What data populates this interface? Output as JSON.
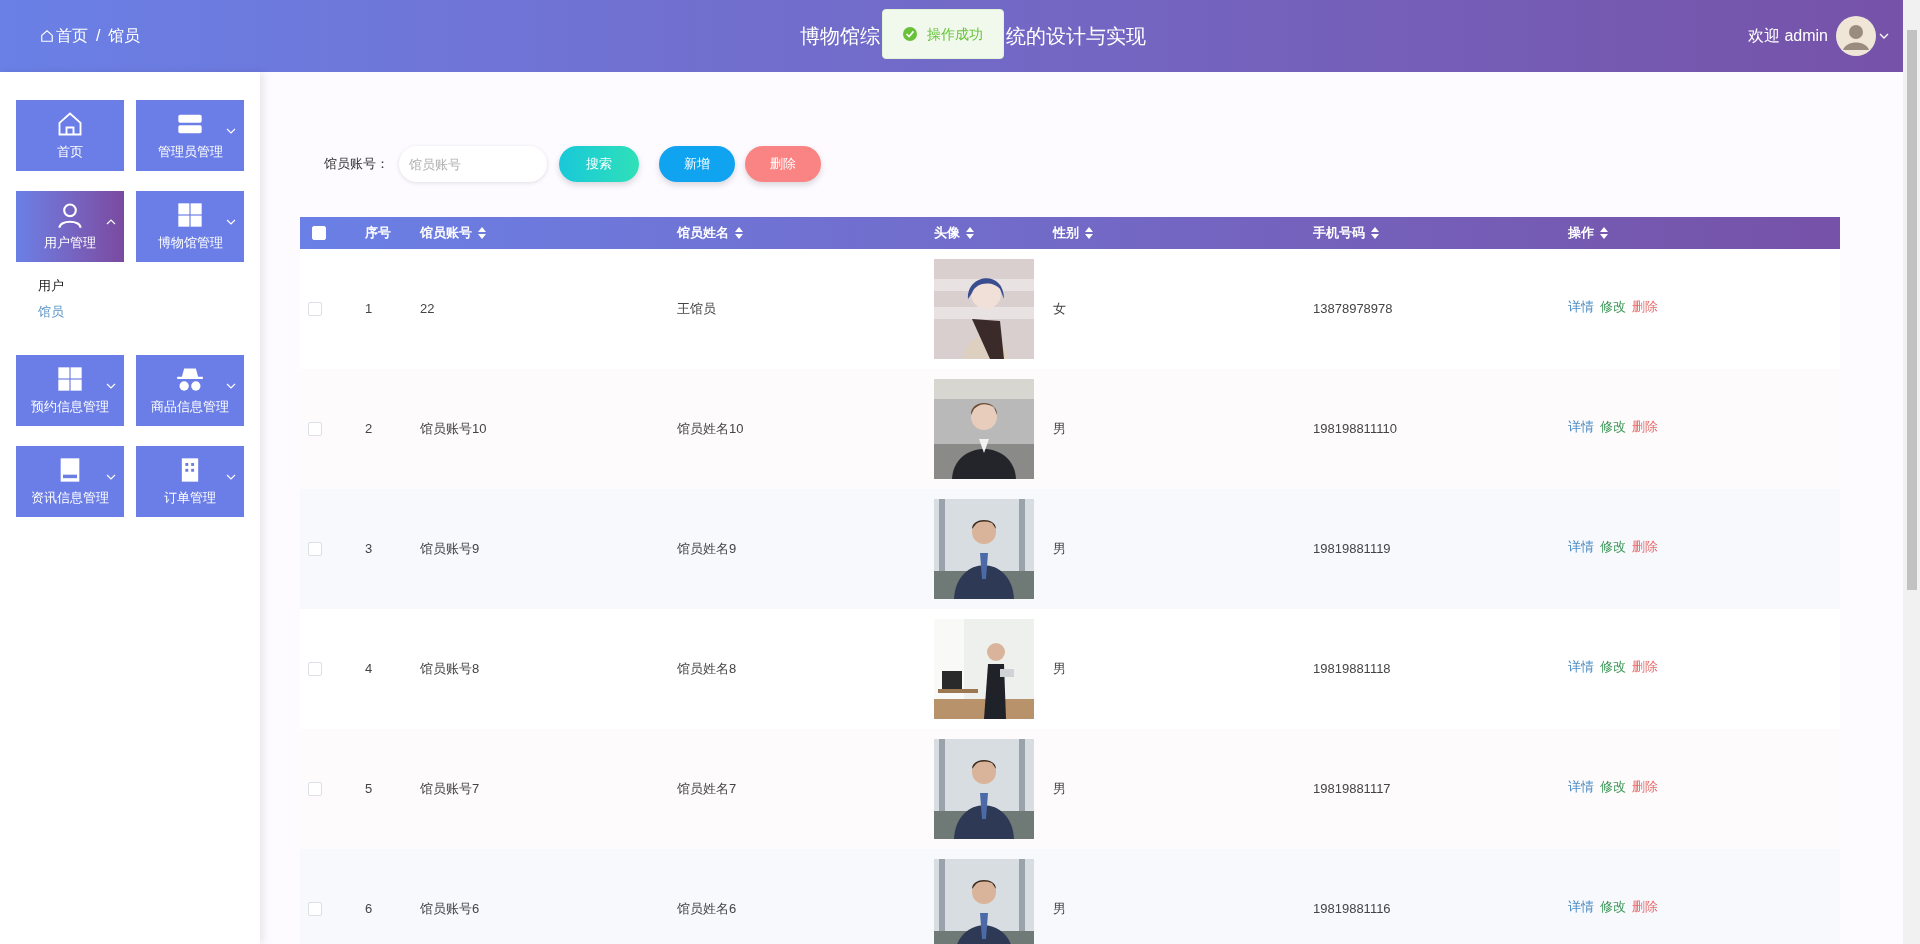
{
  "header": {
    "breadcrumb": [
      "首页",
      "馆员"
    ],
    "separator": "/",
    "title_parts": [
      "博物馆综",
      "统的设计与实现"
    ],
    "toast": "操作成功",
    "welcome": "欢迎 admin"
  },
  "sidebar": {
    "items": [
      {
        "label": "首页",
        "kind": "home",
        "selected": false
      },
      {
        "label": "管理员管理",
        "kind": "bars",
        "selected": false,
        "expanded": false
      },
      {
        "label": "用户管理",
        "kind": "user",
        "selected": true,
        "expanded": true,
        "children": [
          {
            "label": "用户",
            "selected": false
          },
          {
            "label": "馆员",
            "selected": true
          }
        ]
      },
      {
        "label": "博物馆管理",
        "kind": "grid",
        "selected": false,
        "expanded": false
      },
      {
        "label": "预约信息管理",
        "kind": "grid",
        "selected": false,
        "expanded": false
      },
      {
        "label": "商品信息管理",
        "kind": "incognito",
        "selected": false,
        "expanded": false
      },
      {
        "label": "资讯信息管理",
        "kind": "drive",
        "selected": false,
        "expanded": false
      },
      {
        "label": "订单管理",
        "kind": "building",
        "selected": false,
        "expanded": false
      }
    ]
  },
  "search": {
    "label": "馆员账号：",
    "placeholder": "馆员账号"
  },
  "buttons": [
    {
      "label": "搜索",
      "kind": "search"
    },
    {
      "label": "新增",
      "kind": "add"
    },
    {
      "label": "删除",
      "kind": "delete"
    }
  ],
  "table": {
    "select_all_checked": false,
    "columns": [
      "序号",
      "馆员账号",
      "馆员姓名",
      "头像",
      "性别",
      "手机号码",
      "操作"
    ],
    "rows": [
      {
        "checked": false,
        "index": "1",
        "account": "22",
        "name": "王馆员",
        "gender": "女",
        "phone": "13878978978",
        "actions": [
          "详情",
          "修改",
          "删除"
        ]
      },
      {
        "checked": false,
        "index": "2",
        "account": "馆员账号10",
        "name": "馆员姓名10",
        "gender": "男",
        "phone": "198198811110",
        "actions": [
          "详情",
          "修改",
          "删除"
        ]
      },
      {
        "checked": false,
        "index": "3",
        "account": "馆员账号9",
        "name": "馆员姓名9",
        "gender": "男",
        "phone": "19819881119",
        "actions": [
          "详情",
          "修改",
          "删除"
        ]
      },
      {
        "checked": false,
        "index": "4",
        "account": "馆员账号8",
        "name": "馆员姓名8",
        "gender": "男",
        "phone": "19819881118",
        "actions": [
          "详情",
          "修改",
          "删除"
        ]
      },
      {
        "checked": false,
        "index": "5",
        "account": "馆员账号7",
        "name": "馆员姓名7",
        "gender": "男",
        "phone": "19819881117",
        "actions": [
          "详情",
          "修改",
          "删除"
        ]
      },
      {
        "checked": false,
        "index": "6",
        "account": "馆员账号6",
        "name": "馆员姓名6",
        "gender": "男",
        "phone": "19819881116",
        "actions": [
          "详情",
          "修改",
          "删除"
        ]
      }
    ]
  }
}
